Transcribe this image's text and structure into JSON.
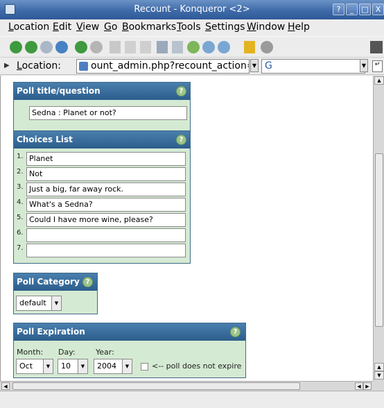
{
  "window": {
    "title": "Recount - Konqueror <2>",
    "buttons": [
      "?",
      "_",
      "□",
      "X"
    ]
  },
  "menu": {
    "items": [
      {
        "label": "Location",
        "underline": "L"
      },
      {
        "label": "Edit",
        "underline": "E"
      },
      {
        "label": "View",
        "underline": "V"
      },
      {
        "label": "Go",
        "underline": "G"
      },
      {
        "label": "Bookmarks",
        "underline": "B"
      },
      {
        "label": "Tools",
        "underline": "T"
      },
      {
        "label": "Settings",
        "underline": "S"
      },
      {
        "label": "Window",
        "underline": "W"
      },
      {
        "label": "Help",
        "underline": "H"
      }
    ]
  },
  "toolbar": {
    "icons": [
      "up-icon",
      "back-icon",
      "forward-icon",
      "home-icon",
      "reload-icon",
      "stop-icon",
      "cut-icon",
      "copy-icon",
      "paste-icon",
      "print-icon",
      "print-frame-icon",
      "zoom-icon",
      "zoom-in-icon",
      "zoom-out-icon",
      "lock-icon",
      "security-icon",
      "throbber-icon"
    ]
  },
  "location": {
    "label_prefix": "L",
    "label_rest": "ocation:",
    "url": "ount_admin.php?recount_action=add",
    "search_engine": "G"
  },
  "poll_title": {
    "header": "Poll title/question",
    "value": "Sedna : Planet or not?"
  },
  "choices": {
    "header": "Choices List",
    "items": [
      {
        "num": "1.",
        "value": "Planet"
      },
      {
        "num": "2.",
        "value": "Not"
      },
      {
        "num": "3.",
        "value": "Just a big, far away rock."
      },
      {
        "num": "4.",
        "value": "What's a Sedna?"
      },
      {
        "num": "5.",
        "value": "Could I have more wine, please?"
      },
      {
        "num": "6.",
        "value": ""
      },
      {
        "num": "7.",
        "value": ""
      }
    ]
  },
  "category": {
    "header": "Poll Category",
    "selected": "default"
  },
  "expiration": {
    "header": "Poll Expiration",
    "month_label": "Month:",
    "day_label": "Day:",
    "year_label": "Year:",
    "month": "Oct",
    "day": "10",
    "year": "2004",
    "no_expire_label": "<-- poll does not expire"
  },
  "help_glyph": "?",
  "colors": {
    "panel_header": "#2c5d8c",
    "panel_bg": "#d5ead3"
  }
}
